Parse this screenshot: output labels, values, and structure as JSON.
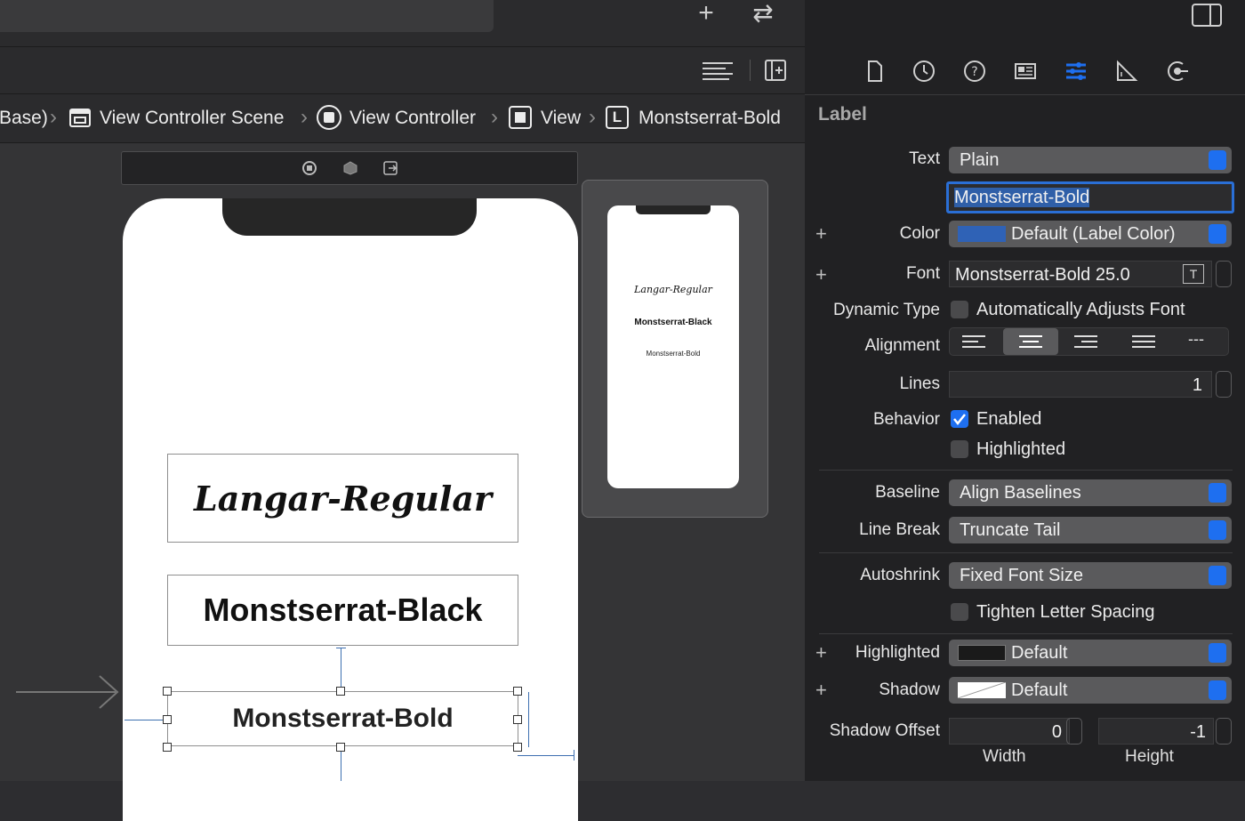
{
  "breadcrumb": {
    "items": [
      "Base)",
      "View Controller Scene",
      "View Controller",
      "View",
      "Monstserrat-Bold"
    ],
    "view_icon_letter": "L"
  },
  "canvas": {
    "labels": [
      "Langar-Regular",
      "Monstserrat-Black",
      "Monstserrat-Bold"
    ]
  },
  "toolbar": {
    "add_glyph": "+",
    "swap_glyph": "⇄"
  },
  "inspector": {
    "section_title": "Label",
    "text": {
      "label": "Text",
      "value": "Plain"
    },
    "text_content": "Monstserrat-Bold",
    "color": {
      "label": "Color",
      "value": "Default (Label Color)",
      "swatch": "#2f62b6"
    },
    "font": {
      "label": "Font",
      "value": "Monstserrat-Bold 25.0"
    },
    "dynamic_type": {
      "label": "Dynamic Type",
      "option": "Automatically Adjusts Font",
      "checked": false
    },
    "alignment": {
      "label": "Alignment",
      "selected": 1
    },
    "lines": {
      "label": "Lines",
      "value": "1"
    },
    "behavior": {
      "label": "Behavior",
      "enabled_label": "Enabled",
      "enabled": true,
      "highlighted_label": "Highlighted",
      "highlighted": false
    },
    "baseline": {
      "label": "Baseline",
      "value": "Align Baselines"
    },
    "line_break": {
      "label": "Line Break",
      "value": "Truncate Tail"
    },
    "autoshrink": {
      "label": "Autoshrink",
      "value": "Fixed Font Size"
    },
    "tighten": {
      "label": "Tighten Letter Spacing",
      "checked": false
    },
    "highlighted_color": {
      "label": "Highlighted",
      "value": "Default",
      "swatch": "#1a1a1a"
    },
    "shadow": {
      "label": "Shadow",
      "value": "Default"
    },
    "shadow_offset": {
      "label": "Shadow Offset",
      "width": "0",
      "height": "-1",
      "width_label": "Width",
      "height_label": "Height"
    },
    "plus_glyph": "+",
    "alignment_dashes": "---"
  },
  "colors": {
    "accent": "#1e6ff0",
    "focus_ring": "#2a6fd6"
  }
}
